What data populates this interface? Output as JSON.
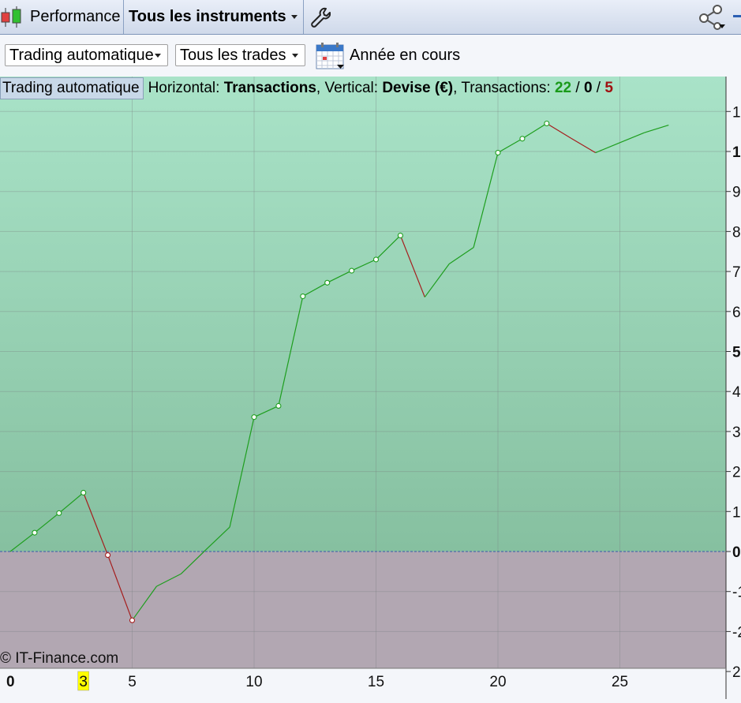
{
  "toolbar": {
    "performance_label": "Performance",
    "instruments_label": "Tous les instruments"
  },
  "filters": {
    "mode_label": "Trading automatique",
    "trades_label": "Tous les trades",
    "period_label": "Année en cours"
  },
  "info": {
    "system_label": "Trading automatique",
    "horizontal_prefix": "Horizontal: ",
    "horizontal_value": "Transactions",
    "vertical_prefix": ", Vertical: ",
    "vertical_value": "Devise (€)",
    "transactions_prefix": ", Transactions: ",
    "wins": "22",
    "sep": " / ",
    "neutral": "0",
    "losses": "5"
  },
  "copyright": "© IT-Finance.com",
  "colors": {
    "positive_area_top": "#a9e3c8",
    "positive_area_bottom": "#86c0a0",
    "negative_area": "#b2a7b2",
    "win_line": "#1e9e1e",
    "loss_line": "#a51d1d",
    "highlight": "#ffff00"
  },
  "chart_data": {
    "type": "line",
    "xlabel": "",
    "ylabel": "",
    "x_ticks": [
      "0",
      "3",
      "5",
      "10",
      "15",
      "20",
      "25"
    ],
    "highlighted_x_tick": "3",
    "y_tick_labels": [
      "1",
      "1",
      "9",
      "8",
      "7",
      "6",
      "5",
      "4",
      "3",
      "2",
      "1",
      "0",
      "-1",
      "-2",
      "2"
    ],
    "xlim": [
      0,
      29
    ],
    "ylim": [
      -2.9,
      11.1
    ],
    "grid": true,
    "series": [
      {
        "x": [
          0,
          1,
          2,
          3,
          4,
          5,
          6,
          7,
          8,
          9,
          10,
          11,
          12,
          13,
          14,
          15,
          16,
          17,
          18,
          19,
          20,
          21,
          22,
          23,
          24,
          25,
          26,
          27
        ],
        "values": [
          0,
          0.47,
          0.96,
          1.47,
          -0.09,
          -1.72,
          -0.87,
          -0.56,
          0.03,
          0.61,
          3.36,
          3.64,
          6.38,
          6.72,
          7.02,
          7.3,
          7.9,
          6.36,
          7.19,
          7.6,
          9.97,
          10.32,
          10.7,
          10.33,
          9.97,
          10.22,
          10.47,
          10.66
        ],
        "markers": [
          1,
          2,
          3,
          4,
          5,
          10,
          11,
          12,
          13,
          14,
          15,
          16,
          20,
          21,
          22
        ]
      }
    ]
  }
}
